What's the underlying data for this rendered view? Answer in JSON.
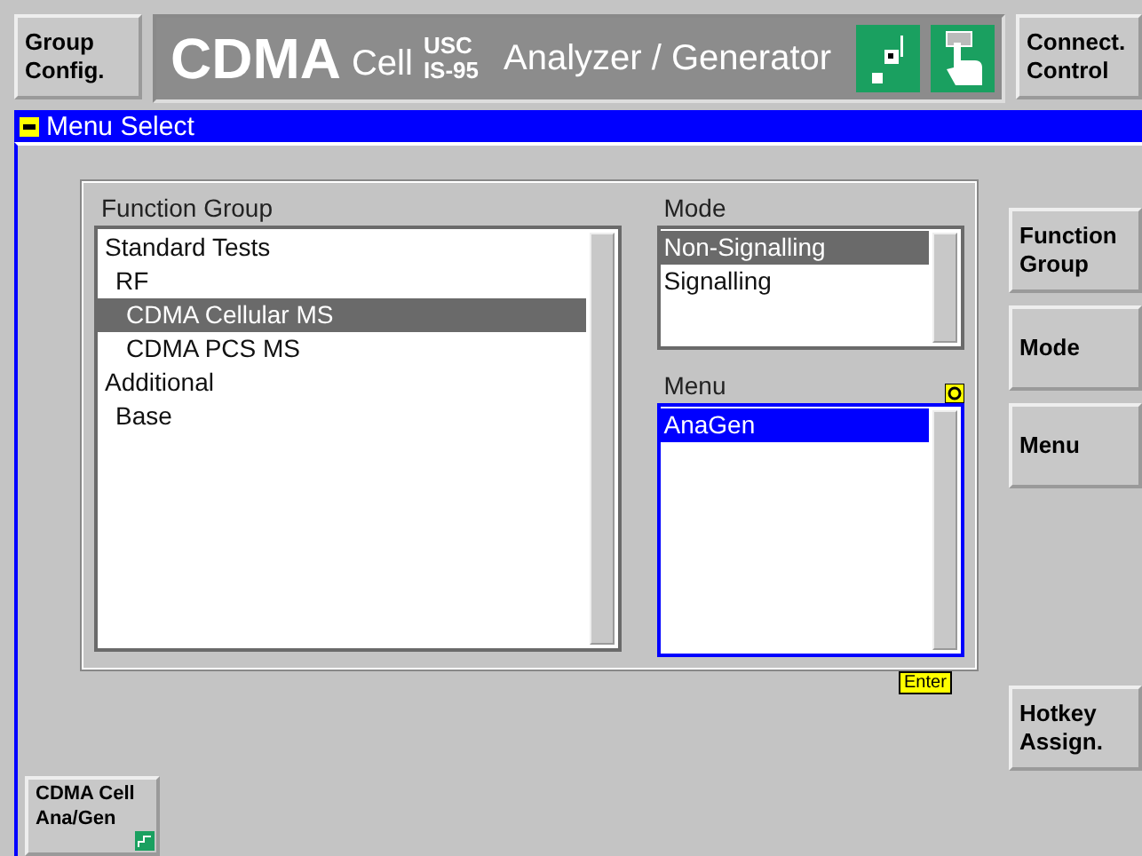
{
  "header": {
    "left_button": [
      "Group",
      "Config."
    ],
    "title": {
      "brand": "CDMA",
      "cell": "Cell",
      "standard_top": "USC",
      "standard_bottom": "IS-95",
      "subtitle": "Analyzer / Generator"
    },
    "right_button": [
      "Connect.",
      "Control"
    ]
  },
  "menu_bar": {
    "title": "Menu Select"
  },
  "function_group": {
    "label": "Function Group",
    "items": [
      {
        "label": "Standard Tests",
        "selected": false,
        "children": [
          {
            "label": "RF",
            "selected": false,
            "children": [
              {
                "label": "CDMA Cellular MS",
                "selected": true
              },
              {
                "label": "CDMA PCS MS",
                "selected": false
              }
            ]
          }
        ]
      },
      {
        "label": "Additional",
        "selected": false,
        "children": [
          {
            "label": "Base",
            "selected": false
          }
        ]
      }
    ]
  },
  "mode": {
    "label": "Mode",
    "items": [
      {
        "label": "Non-Signalling",
        "selected": true
      },
      {
        "label": "Signalling",
        "selected": false
      }
    ]
  },
  "menu": {
    "label": "Menu",
    "focused": true,
    "items": [
      {
        "label": "AnaGen",
        "selected": true
      }
    ]
  },
  "enter_hint": "Enter",
  "softkeys": [
    {
      "label": [
        "Function",
        "Group"
      ]
    },
    {
      "label": [
        "Mode"
      ]
    },
    {
      "label": [
        "Menu"
      ]
    }
  ],
  "hotkey_button": [
    "Hotkey",
    "Assign."
  ],
  "bottom_button": [
    "CDMA Cell",
    "Ana/Gen"
  ]
}
